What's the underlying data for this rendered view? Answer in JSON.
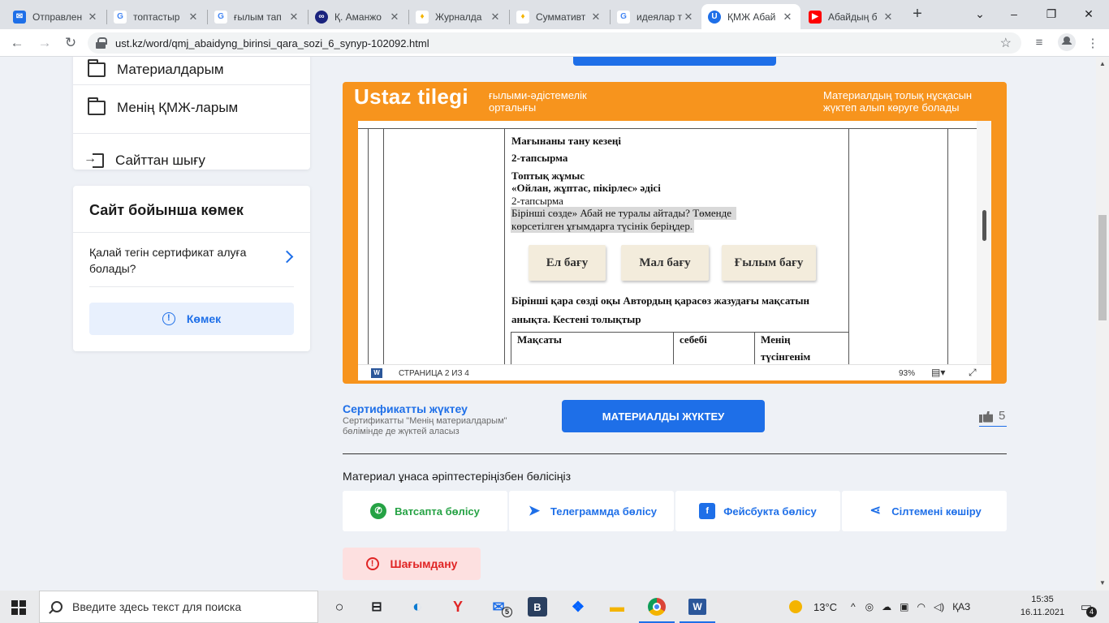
{
  "browser": {
    "tabs": [
      {
        "title": "Отправлен",
        "favicon_color": "#1e6fe8",
        "favicon": "mail-icon",
        "active": false
      },
      {
        "title": "топтастыр",
        "favicon_color": "#4285f4",
        "favicon": "google-icon",
        "active": false
      },
      {
        "title": "ғылым тап",
        "favicon_color": "#4285f4",
        "favicon": "google-icon",
        "active": false
      },
      {
        "title": "Қ. Аманжо",
        "favicon_color": "#1a237e",
        "favicon": "site-icon",
        "active": false
      },
      {
        "title": "Журналда",
        "favicon_color": "#f4b400",
        "favicon": "site-icon",
        "active": false
      },
      {
        "title": "Суммативт",
        "favicon_color": "#f4b400",
        "favicon": "site-icon",
        "active": false
      },
      {
        "title": "идеялар та",
        "favicon_color": "#4285f4",
        "favicon": "google-icon",
        "active": false
      },
      {
        "title": "ҚМЖ Абай",
        "favicon_color": "#1e6fe8",
        "favicon": "ustaz-icon",
        "active": true
      },
      {
        "title": "Абайдың б",
        "favicon_color": "#ff0000",
        "favicon": "youtube-icon",
        "active": false
      }
    ],
    "url": "ust.kz/word/qmj_abaidyng_birinsi_qara_sozi_6_synyp-102092.html"
  },
  "sidebar": {
    "menu": [
      {
        "label": "Материалдарым"
      },
      {
        "label": "Менің ҚМЖ-ларым"
      },
      {
        "label": "Сайттан шығу"
      }
    ],
    "help": {
      "title": "Сайт бойынша көмек",
      "question": "Қалай тегін сертификат алуға болады?",
      "button": "Көмек"
    }
  },
  "viewer": {
    "brand": "Ustaz tilegi",
    "brand_sub": "ғылыми-әдістемелік орталығы",
    "brand_right": "Материалдың толық нұсқасын жүктеп алып көруге болады",
    "doc": {
      "stage": "Мағынаны тану кезеңі",
      "task": "2-тапсырма",
      "group_work": "Топтық жұмыс",
      "method": "«Ойлан, жұптас, пікірлес» әдісі",
      "task2": "2-тапсырма",
      "question_line1": "Бірінші сөзде» Абай не туралы айтады? Төменде",
      "question_line2": "көрсетілген ұғымдарға түсінік беріңдер.",
      "cards": [
        "Ел бағу",
        "Мал бағу",
        "Ғылым бағу"
      ],
      "read_line1": "Бірінші қара сөзді оқы Автордың қарасөз жазудағы мақсатын",
      "read_line2": "анықта. Кестені толықтыр",
      "table_headers": [
        "Мақсаты",
        "себебі",
        "Менің"
      ],
      "table_header_cont": "түсінгенім"
    },
    "status": {
      "page": "СТРАНИЦА 2 ИЗ 4",
      "zoom": "93%"
    }
  },
  "certificate": {
    "link": "Сертификатты жүктеу",
    "note": "Сертификатты \"Менің материалдарым\" бөлімінде де жүктей аласыз"
  },
  "download_button": "МАТЕРИАЛДЫ ЖҮКТЕУ",
  "likes": "5",
  "share": {
    "label": "Материал ұнаса әріптестеріңізбен бөлісіңіз",
    "buttons": [
      {
        "label": "Ватсапта бөлісу",
        "color": "#25a244"
      },
      {
        "label": "Телеграммда бөлісу",
        "color": "#1e6fe8"
      },
      {
        "label": "Фейсбукта бөлісу",
        "color": "#1e6fe8"
      },
      {
        "label": "Сілтемені көшіру",
        "color": "#1e6fe8"
      }
    ]
  },
  "complain": "Шағымдану",
  "taskbar": {
    "search_placeholder": "Введите здесь текст для поиска",
    "mail_badge": "5",
    "temperature": "13°C",
    "lang": "ҚАЗ",
    "time": "15:35",
    "date": "16.11.2021",
    "notifications": "4"
  }
}
